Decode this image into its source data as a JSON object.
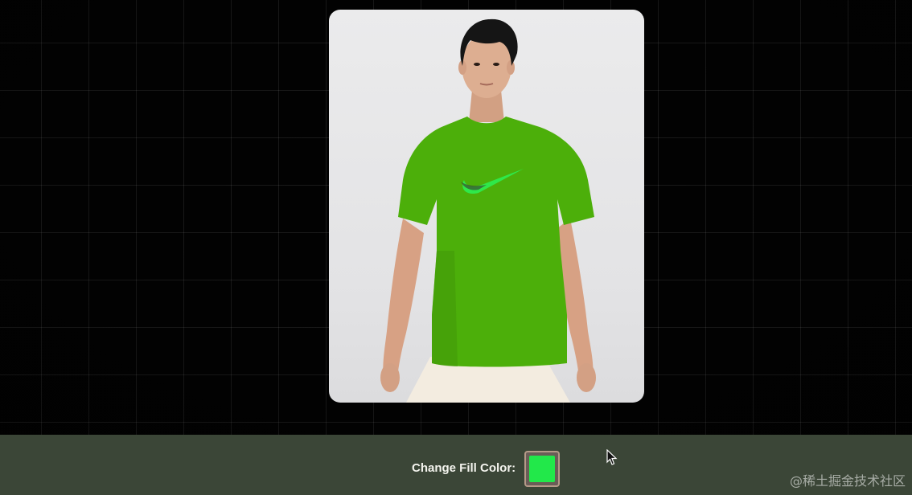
{
  "scene": {
    "description_free": true
  },
  "preview": {
    "shirt_color": "#4caf0a",
    "shirt_shadow_color": "#3f9608",
    "swoosh_color": "#2fe84a",
    "skin_color": "#d9a98c",
    "hair_color": "#151515",
    "shorts_color": "#f3ece0"
  },
  "controls": {
    "fill_label": "Change Fill Color:",
    "fill_color": "#22e84a"
  },
  "watermark": {
    "text": "@稀土掘金技术社区"
  },
  "icons": {
    "cursor": "mouse-pointer-icon"
  }
}
